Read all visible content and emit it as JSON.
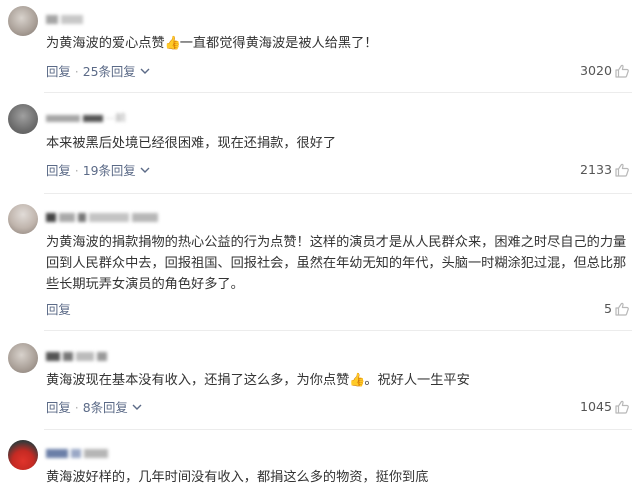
{
  "comments": [
    {
      "username_visible": "",
      "text_before": "为黄海波的爱心点赞",
      "text_after": "一直都觉得黄海波是被人给黑了！",
      "reply_label": "回复",
      "reply_count_label": "25条回复",
      "likes": "3020"
    },
    {
      "username_visible": "··前",
      "text": "本来被黑后处境已经很困难，现在还捐款，很好了",
      "reply_label": "回复",
      "reply_count_label": "19条回复",
      "likes": "2133"
    },
    {
      "username_visible": "",
      "text": "为黄海波的捐款捐物的热心公益的行为点赞！这样的演员才是从人民群众来，困难之时尽自己的力量回到人民群众中去，回报祖国、回报社会，虽然在年幼无知的年代，头脑一时糊涂犯过混，但总比那些长期玩弄女演员的角色好多了。",
      "reply_label": "回复",
      "likes": "5"
    },
    {
      "username_visible": "",
      "text_before": "黄海波现在基本没有收入，还捐了这么多，为你点赞",
      "text_after": "。祝好人一生平安",
      "reply_label": "回复",
      "reply_count_label": "8条回复",
      "likes": "1045"
    },
    {
      "username_visible": "",
      "text": "黄海波好样的，几年时间没有收入，都捐这么多的物资，挺你到底"
    }
  ],
  "colors": {
    "action_text": "#5b6a87",
    "body_text": "#333333",
    "like_count": "#555555",
    "thumb_emoji": "#f0a93a"
  },
  "icons": {
    "like": "thumb-up-outline-icon",
    "expand": "chevron-down-icon",
    "inline_emoji": "thumbs-up-emoji"
  }
}
